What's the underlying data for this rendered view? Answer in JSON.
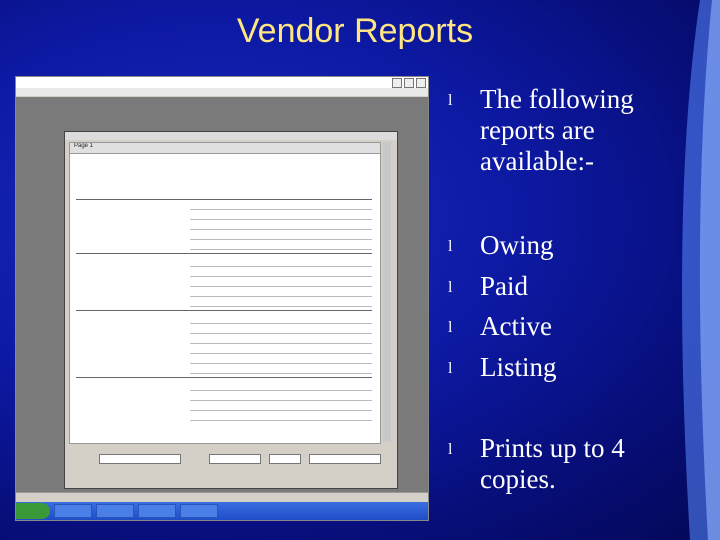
{
  "slide": {
    "title": "Vendor Reports",
    "title_color": "#ffe680",
    "bullet_glyph": "l",
    "bullets": [
      {
        "text": "The following reports are available:-"
      },
      {
        "text": "Owing"
      },
      {
        "text": "Paid"
      },
      {
        "text": "Active"
      },
      {
        "text": "Listing"
      },
      {
        "text": "Prints up to 4 copies."
      }
    ]
  },
  "screenshot": {
    "page_label": "Page 1"
  }
}
